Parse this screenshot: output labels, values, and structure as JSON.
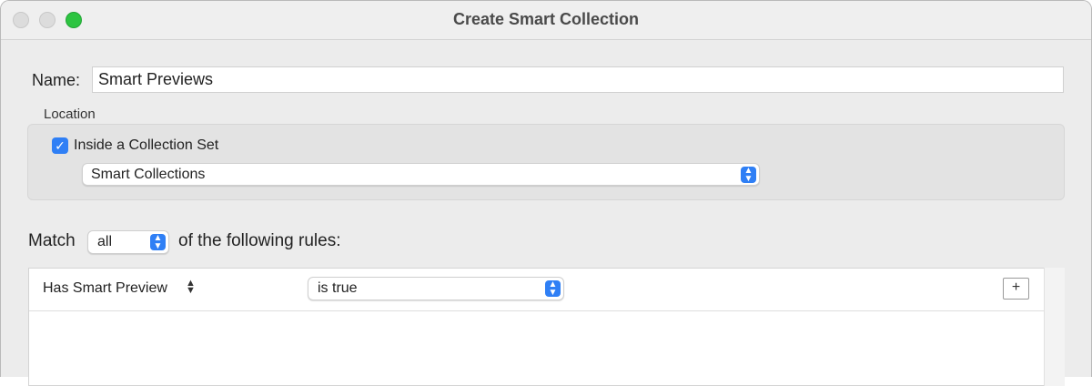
{
  "window": {
    "title": "Create Smart Collection",
    "accent_color": "#2f7ff5",
    "zoom_button_color": "#2dc441"
  },
  "name": {
    "label": "Name:",
    "value": "Smart Previews"
  },
  "location": {
    "label": "Location",
    "inside_set_checked": true,
    "inside_set_label": "Inside a Collection Set",
    "collection_set": "Smart Collections"
  },
  "match": {
    "prefix": "Match",
    "value": "all",
    "suffix": "of the following rules:"
  },
  "rules": [
    {
      "field": "Has Smart Preview",
      "operator": "is true",
      "add_label": "+"
    }
  ]
}
